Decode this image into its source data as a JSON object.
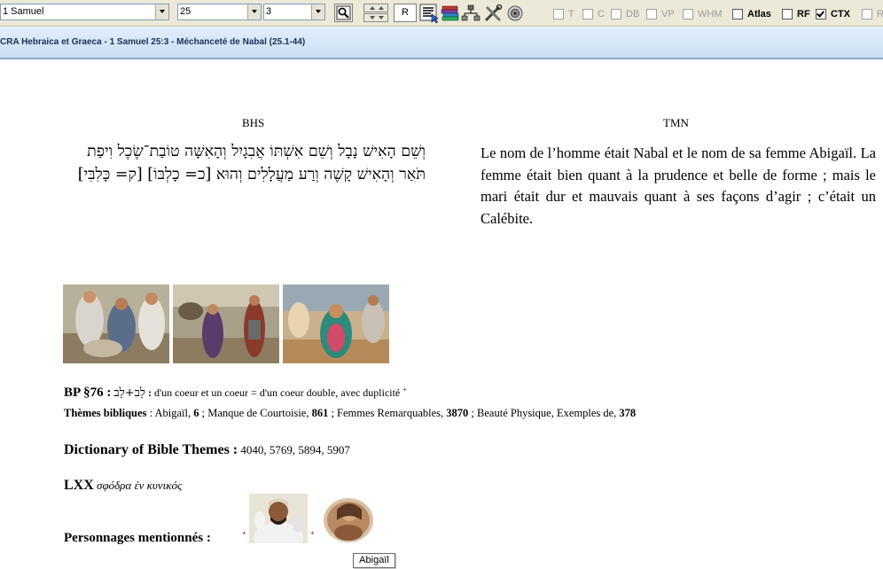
{
  "toolbar": {
    "book": "1 Samuel",
    "chapter": "25",
    "verse": "3",
    "r_label": "R",
    "checkboxes": [
      {
        "label": "T",
        "checked": false
      },
      {
        "label": "C",
        "checked": false
      },
      {
        "label": "DB",
        "checked": false
      },
      {
        "label": "VP",
        "checked": false
      },
      {
        "label": "WHM",
        "checked": false
      },
      {
        "label": "Atlas",
        "checked": false
      },
      {
        "label": "RF",
        "checked": false
      },
      {
        "label": "CTX",
        "checked": true
      },
      {
        "label": "R",
        "checked": false
      }
    ]
  },
  "titlebar": {
    "title": "CRA Hebraica et Graeca - 1 Samuel 25:3 - Méchanceté de Nabal (25.1-44)"
  },
  "columns": {
    "left_header": "BHS",
    "right_header": "TMN",
    "hebrew_text": "וְשֵׁם הָאִישׁ נָבָל וְשֵׁם אִשְׁתּוֹ אֲבִגָיִל וְהָאִשָּׁה טוֹבַת־שֶׂכֶל וִיפַת תֹּאַר וְהָאִישׁ קָשֶׁה וְרַע מַעֲלָלִים וְהוּא [כ= כָלְבּוֹ] [ק= כָּלִבִּי]׃",
    "french_text": "Le nom de l’homme était Nabal et le nom de sa femme Abigaïl. La femme était bien quant à la prudence et belle de forme ; mais le mari était dur et mauvais quant à ses façons d’agir ; c’était un Calébite."
  },
  "bp": {
    "label": "BP §76 :",
    "hebrew": "לֵב+לֵב",
    "sep": " : ",
    "text": "d'un coeur et un coeur = d'un coeur double, avec duplicité",
    "mark": "+"
  },
  "themes": {
    "label": "Thèmes bibliques",
    "colon": " : ",
    "items": [
      {
        "name": "Abigaïl",
        "num": "6"
      },
      {
        "name": "Manque de Courtoisie",
        "num": "861"
      },
      {
        "name": "Femmes Remarquables",
        "num": "3870"
      },
      {
        "name": "Beauté Physique, Exemples de",
        "num": "378"
      }
    ]
  },
  "dictionary": {
    "label": "Dictionary of Bible Themes :",
    "refs": "4040, 5769, 5894, 5907"
  },
  "lxx": {
    "label": "LXX",
    "text": "σφόδρα ἐν κυνικός"
  },
  "persons": {
    "label": "Personnages mentionnés :",
    "mark1": "+",
    "mark2": "+",
    "tooltip": "Abigaïl"
  },
  "colors": {
    "titlebar_text": "#1b2e55",
    "toolbar_bg": "#ece9d8",
    "titlebar_bg": "#c9dff4"
  }
}
